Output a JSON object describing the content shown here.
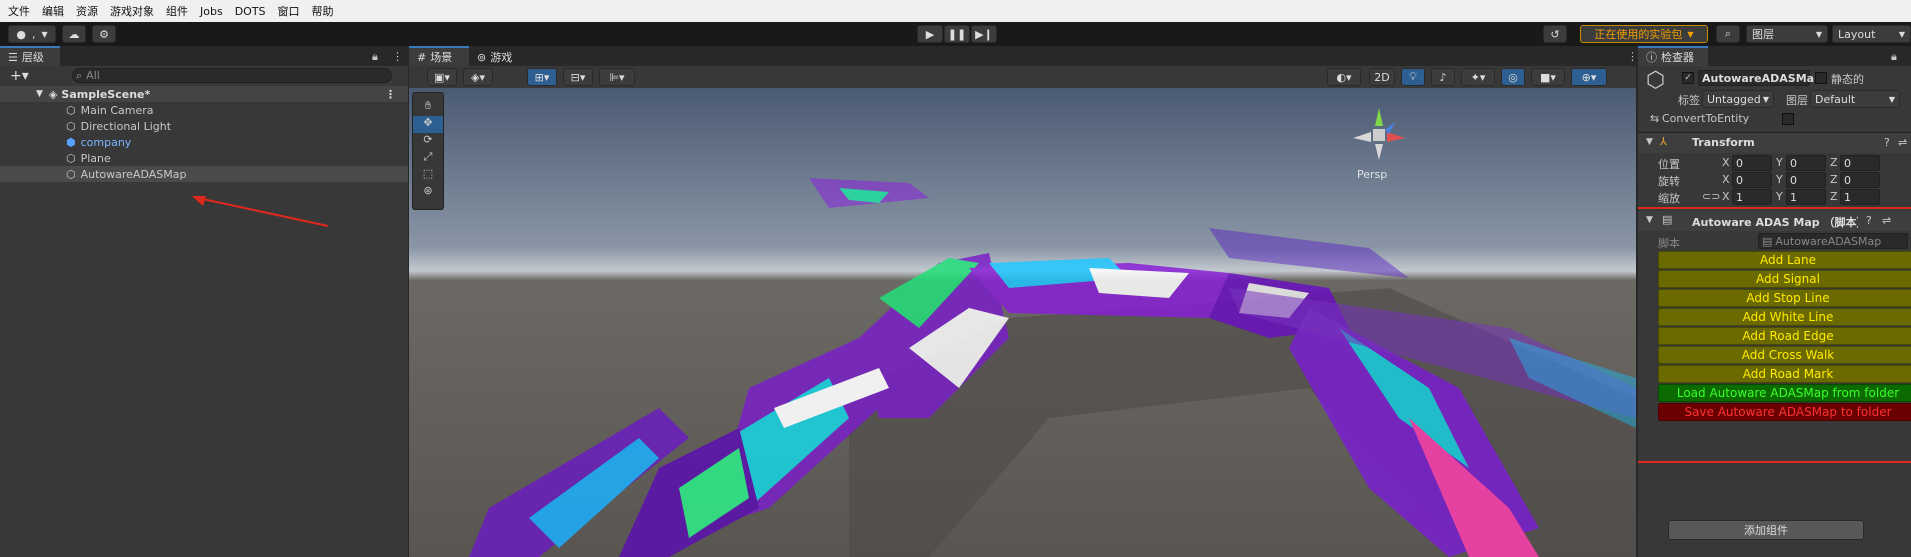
{
  "menu": [
    "文件",
    "编辑",
    "资源",
    "游戏对象",
    "组件",
    "Jobs",
    "DOTS",
    "窗口",
    "帮助"
  ],
  "toolbar": {
    "account_label": ",",
    "preview_pkg": "正在使用的实验包",
    "layers": "图层",
    "layout": "Layout"
  },
  "hierarchy": {
    "tab": "层级",
    "search_placeholder": "All",
    "scene": "SampleScene*",
    "items": [
      "Main Camera",
      "Directional Light",
      "company",
      "Plane",
      "AutowareADASMap"
    ]
  },
  "scene_view": {
    "tab_scene": "场景",
    "tab_game": "游戏",
    "mode_2d": "2D",
    "persp": "Persp"
  },
  "inspector": {
    "tab": "检查器",
    "object_name": "AutowareADASMap",
    "static_label": "静态的",
    "tag_label": "标签",
    "tag_value": "Untagged",
    "layer_label": "图层",
    "layer_value": "Default",
    "convert_label": "ConvertToEntity",
    "transform_title": "Transform",
    "pos_label": "位置",
    "rot_label": "旋转",
    "scale_label": "缩放",
    "x": "X",
    "y": "Y",
    "z": "Z",
    "pos": [
      "0",
      "0",
      "0"
    ],
    "rot": [
      "0",
      "0",
      "0"
    ],
    "scale": [
      "1",
      "1",
      "1"
    ],
    "script_comp_title": "Autoware ADAS Map （脚本）",
    "script_label": "脚本",
    "script_value": "AutowareADASMap",
    "buttons": [
      "Add Lane",
      "Add Signal",
      "Add Stop Line",
      "Add White Line",
      "Add Road Edge",
      "Add Cross Walk",
      "Add Road Mark"
    ],
    "load_button": "Load Autoware ADASMap from folder",
    "save_button": "Save Autoware ADASMap to folder",
    "add_component": "添加组件"
  }
}
